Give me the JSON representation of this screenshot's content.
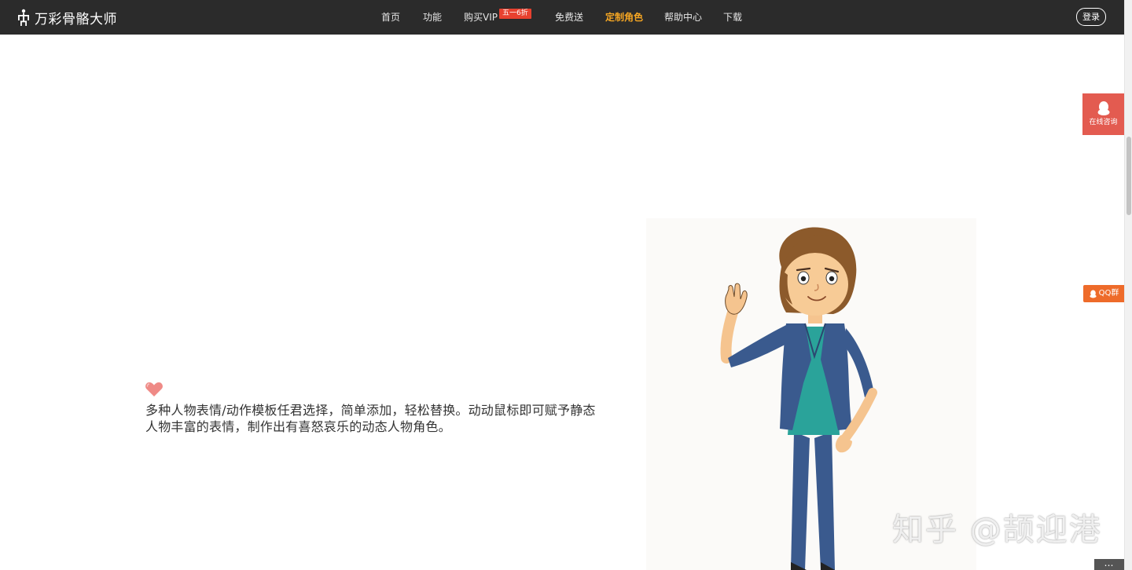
{
  "header": {
    "logo_text": "万彩骨骼大师",
    "nav": [
      {
        "label": "首页"
      },
      {
        "label": "功能"
      },
      {
        "label": "购买VIP"
      },
      {
        "label": "免费送"
      },
      {
        "label": "定制角色"
      },
      {
        "label": "帮助中心"
      },
      {
        "label": "下载"
      }
    ],
    "promo_badge": "五一6折",
    "active_nav": "定制角色",
    "login_label": "登录"
  },
  "content": {
    "description": "多种人物表情/动作模板任君选择，简单添加，轻松替换。动动鼠标即可赋予静态人物丰富的表情，制作出有喜怒哀乐的动态人物角色。",
    "figure_icon": "waving-woman-illustration"
  },
  "sidebar": {
    "consult_label": "在线咨询",
    "qq_label": "QQ群"
  },
  "watermark": "知乎 @颉迎港",
  "more_label": "…",
  "colors": {
    "nav_bg": "#2b2b2b",
    "active_nav": "#f5a623",
    "badge": "#e8412f",
    "consult": "#e35b50",
    "qq": "#ee6b2a"
  }
}
